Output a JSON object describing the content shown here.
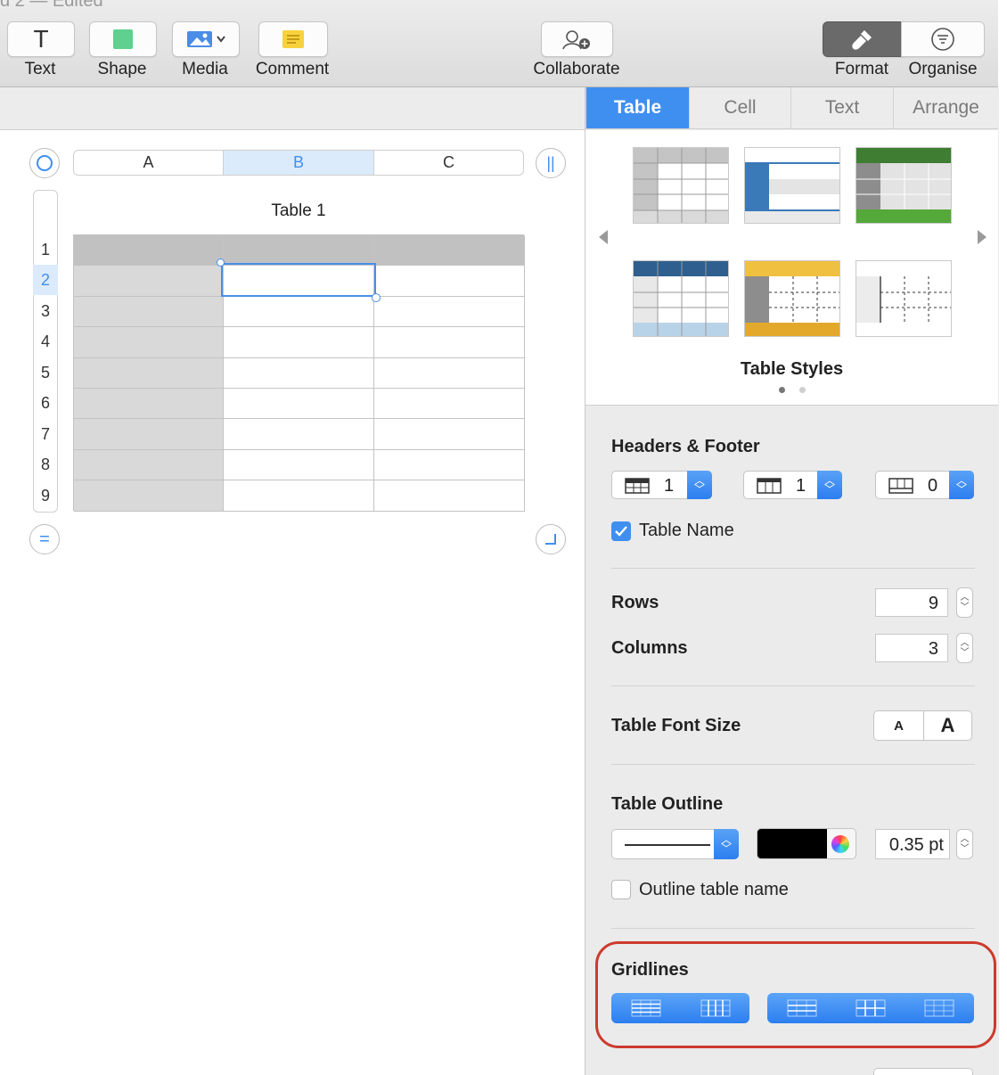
{
  "window": {
    "title_fragment": "d 2 — Edited"
  },
  "toolbar": {
    "text": "Text",
    "shape": "Shape",
    "media": "Media",
    "comment": "Comment",
    "collaborate": "Collaborate",
    "format": "Format",
    "organise": "Organise"
  },
  "format_tabs": [
    "Table",
    "Cell",
    "Text",
    "Arrange"
  ],
  "sheet": {
    "columns": [
      "A",
      "B",
      "C"
    ],
    "rows": [
      "1",
      "2",
      "3",
      "4",
      "5",
      "6",
      "7",
      "8",
      "9"
    ],
    "table_title": "Table 1",
    "selected_column": "B",
    "selected_row": "2"
  },
  "table_styles": {
    "label": "Table Styles"
  },
  "headers_footer": {
    "label": "Headers & Footer",
    "header_rows": "1",
    "header_columns": "1",
    "footer_rows": "0",
    "table_name_label": "Table Name",
    "table_name_checked": true
  },
  "rows_columns": {
    "rows_label": "Rows",
    "rows_value": "9",
    "columns_label": "Columns",
    "columns_value": "3"
  },
  "font_size": {
    "label": "Table Font Size",
    "small": "A",
    "large": "A"
  },
  "outline": {
    "label": "Table Outline",
    "color": "#000000",
    "width": "0.35 pt",
    "outline_name_label": "Outline table name",
    "outline_name_checked": false
  },
  "gridlines": {
    "label": "Gridlines"
  },
  "colors": {
    "accent": "#3f8ff0",
    "highlight_ring": "#cc3b2e"
  }
}
